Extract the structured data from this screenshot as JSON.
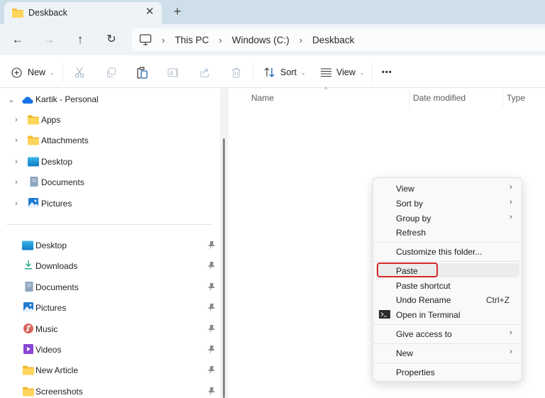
{
  "tab": {
    "title": "Deskback",
    "close_icon": "close-icon",
    "new_tab_icon": "plus-icon"
  },
  "nav": {
    "back_icon": "arrow-left-icon",
    "forward_icon": "arrow-right-icon",
    "up_icon": "arrow-up-icon",
    "refresh_icon": "refresh-icon",
    "breadcrumb": [
      "This PC",
      "Windows (C:)",
      "Deskback"
    ]
  },
  "toolbar": {
    "new_label": "New",
    "sort_label": "Sort",
    "view_label": "View",
    "more_label": "•••",
    "icons": [
      "cut-icon",
      "copy-icon",
      "paste-icon",
      "rename-icon",
      "share-icon",
      "delete-icon"
    ]
  },
  "sidebar": {
    "onedrive": {
      "label": "Kartik - Personal",
      "children": [
        "Apps",
        "Attachments",
        "Desktop",
        "Documents",
        "Pictures"
      ]
    },
    "quick_access": [
      "Desktop",
      "Downloads",
      "Documents",
      "Pictures",
      "Music",
      "Videos",
      "New Article",
      "Screenshots"
    ]
  },
  "filelist": {
    "columns": [
      "Name",
      "Date modified",
      "Type"
    ]
  },
  "context_menu": {
    "items": [
      {
        "label": "View",
        "submenu": true
      },
      {
        "label": "Sort by",
        "submenu": true
      },
      {
        "label": "Group by",
        "submenu": true
      },
      {
        "label": "Refresh"
      },
      {
        "label": "Customize this folder..."
      },
      {
        "label": "Paste",
        "highlighted": true
      },
      {
        "label": "Paste shortcut"
      },
      {
        "label": "Undo Rename",
        "shortcut": "Ctrl+Z"
      },
      {
        "label": "Open in Terminal",
        "icon": "terminal-icon"
      },
      {
        "label": "Give access to",
        "submenu": true
      },
      {
        "label": "New",
        "submenu": true
      },
      {
        "label": "Properties"
      }
    ],
    "submenu_glyph": "›"
  },
  "colors": {
    "highlight": "#d62828",
    "accent": "#0067c0",
    "folder": "#f5c342"
  }
}
